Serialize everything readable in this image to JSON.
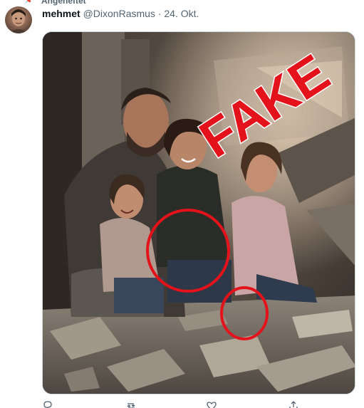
{
  "context": {
    "label": "Angeheftet",
    "icon": "pin-icon"
  },
  "tweet": {
    "display_name": "mehmet",
    "handle": "@DixonRasmus",
    "separator": "·",
    "date": "24. Okt."
  },
  "media": {
    "overlay_text": "FAKE",
    "overlay_color": "#e3121b",
    "circle_color": "#e3121b"
  },
  "actions": [
    {
      "name": "reply-icon"
    },
    {
      "name": "retweet-icon"
    },
    {
      "name": "like-icon"
    },
    {
      "name": "share-icon"
    }
  ],
  "colors": {
    "text_primary": "#0f1419",
    "text_secondary": "#536471",
    "border": "#cfd9de"
  }
}
